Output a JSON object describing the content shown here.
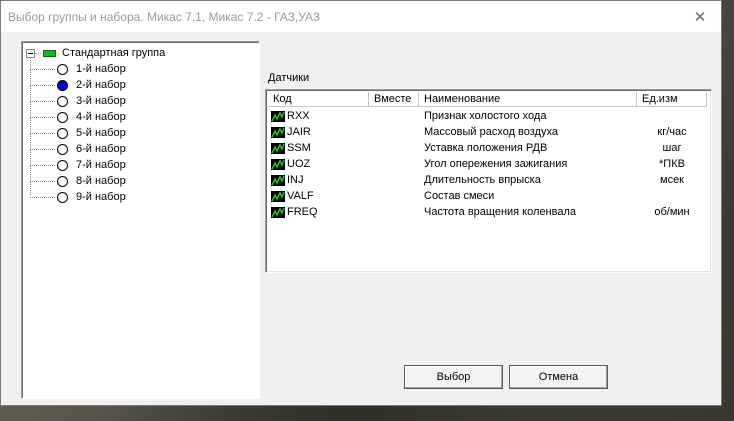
{
  "window": {
    "title": "Выбор группы и набора. Микас 7.1, Микас 7.2 - ГАЗ,УАЗ",
    "close_glyph": "✕"
  },
  "tree": {
    "root_label": "Стандартная группа",
    "items": [
      {
        "label": "1-й набор",
        "selected": false
      },
      {
        "label": "2-й набор",
        "selected": true
      },
      {
        "label": "3-й набор",
        "selected": false
      },
      {
        "label": "4-й набор",
        "selected": false
      },
      {
        "label": "5-й набор",
        "selected": false
      },
      {
        "label": "6-й набор",
        "selected": false
      },
      {
        "label": "7-й набор",
        "selected": false
      },
      {
        "label": "8-й набор",
        "selected": false
      },
      {
        "label": "9-й набор",
        "selected": false
      }
    ]
  },
  "sensors": {
    "label": "Датчики",
    "columns": {
      "code": "Код",
      "together": "Вместе",
      "name": "Наименование",
      "unit": "Ед.изм"
    },
    "rows": [
      {
        "code": "RXX",
        "together": "",
        "name": "Признак холостого хода",
        "unit": ""
      },
      {
        "code": "JAIR",
        "together": "",
        "name": "Массовый расход  воздуха",
        "unit": "кг/час"
      },
      {
        "code": "SSM",
        "together": "",
        "name": "Уставка положения РДВ",
        "unit": "шаг"
      },
      {
        "code": "UOZ",
        "together": "",
        "name": "Угол опережения зажигания",
        "unit": "*ПКВ"
      },
      {
        "code": "INJ",
        "together": "",
        "name": "Длительность впрыска",
        "unit": "мсек"
      },
      {
        "code": "VALF",
        "together": "",
        "name": "Состав смеси",
        "unit": ""
      },
      {
        "code": "FREQ",
        "together": "",
        "name": "Частота вращения коленвала",
        "unit": "об/мин"
      }
    ]
  },
  "buttons": {
    "ok_label": "Выбор",
    "cancel_label": "Отмена"
  },
  "colors": {
    "selected_radio": "#0000e0",
    "group_icon": "#1fb32a",
    "sensor_icon_line": "#22cc22"
  },
  "icons": {
    "close": "close-icon",
    "group": "group-icon",
    "sensor": "sensor-graph-icon",
    "expander": "tree-collapse-icon"
  }
}
